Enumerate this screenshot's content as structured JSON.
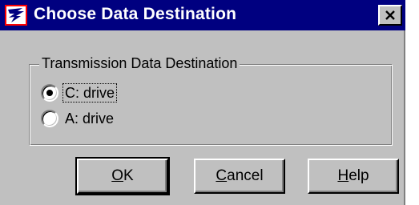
{
  "window": {
    "title": "Choose Data Destination",
    "close_icon": "close-icon",
    "app_icon": "eagle-logo-icon"
  },
  "group": {
    "title": "Transmission Data Destination",
    "options": [
      {
        "label": "C: drive",
        "selected": true
      },
      {
        "label": "A: drive",
        "selected": false
      }
    ]
  },
  "buttons": {
    "ok": {
      "mnemonic": "O",
      "rest": "K"
    },
    "cancel": {
      "mnemonic": "C",
      "rest": "ancel"
    },
    "help": {
      "mnemonic": "H",
      "rest": "elp"
    }
  },
  "colors": {
    "titlebar": "#000080",
    "face": "#c0c0c0",
    "icon_border": "#ff0000"
  }
}
